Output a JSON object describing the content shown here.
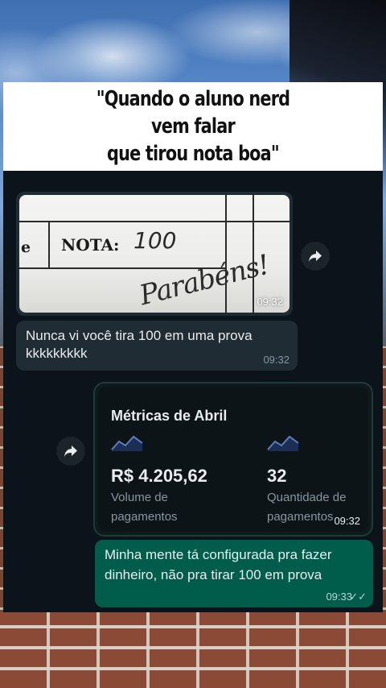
{
  "caption": {
    "text": "\"Quando o aluno nerd vem falar\nque tirou nota boa\""
  },
  "chat": {
    "image_message": {
      "nota_label": "NOTA:",
      "e_label": "e",
      "nota_value": "100",
      "handwriting": "Parabéns!",
      "time": "09:32"
    },
    "incoming_text": {
      "text": "Nunca vi você tira 100 em uma prova kkkkkkkkk",
      "time": "09:32"
    },
    "metrics_card": {
      "title": "Métricas de Abril",
      "metric1": {
        "value": "R$ 4.205,62",
        "label": "Volume de pagamentos"
      },
      "metric2": {
        "value": "32",
        "label": "Quantidade de pagamentos"
      },
      "time": "09:32"
    },
    "outgoing_text": {
      "text": "Minha mente tá configurada pra fazer dinheiro, não pra tirar 100 em prova",
      "time": "09:33",
      "status": "✓✓"
    },
    "icons": {
      "forward": "forward-arrow-icon",
      "sparkline": "sparkline-icon"
    },
    "colors": {
      "chat_bg": "#0b141a",
      "incoming_bubble": "#1f2c34",
      "outgoing_bubble": "#005c4b",
      "text_primary": "#e9edef",
      "text_secondary": "#8696a0",
      "sparkline": "#5b7cc9"
    }
  }
}
